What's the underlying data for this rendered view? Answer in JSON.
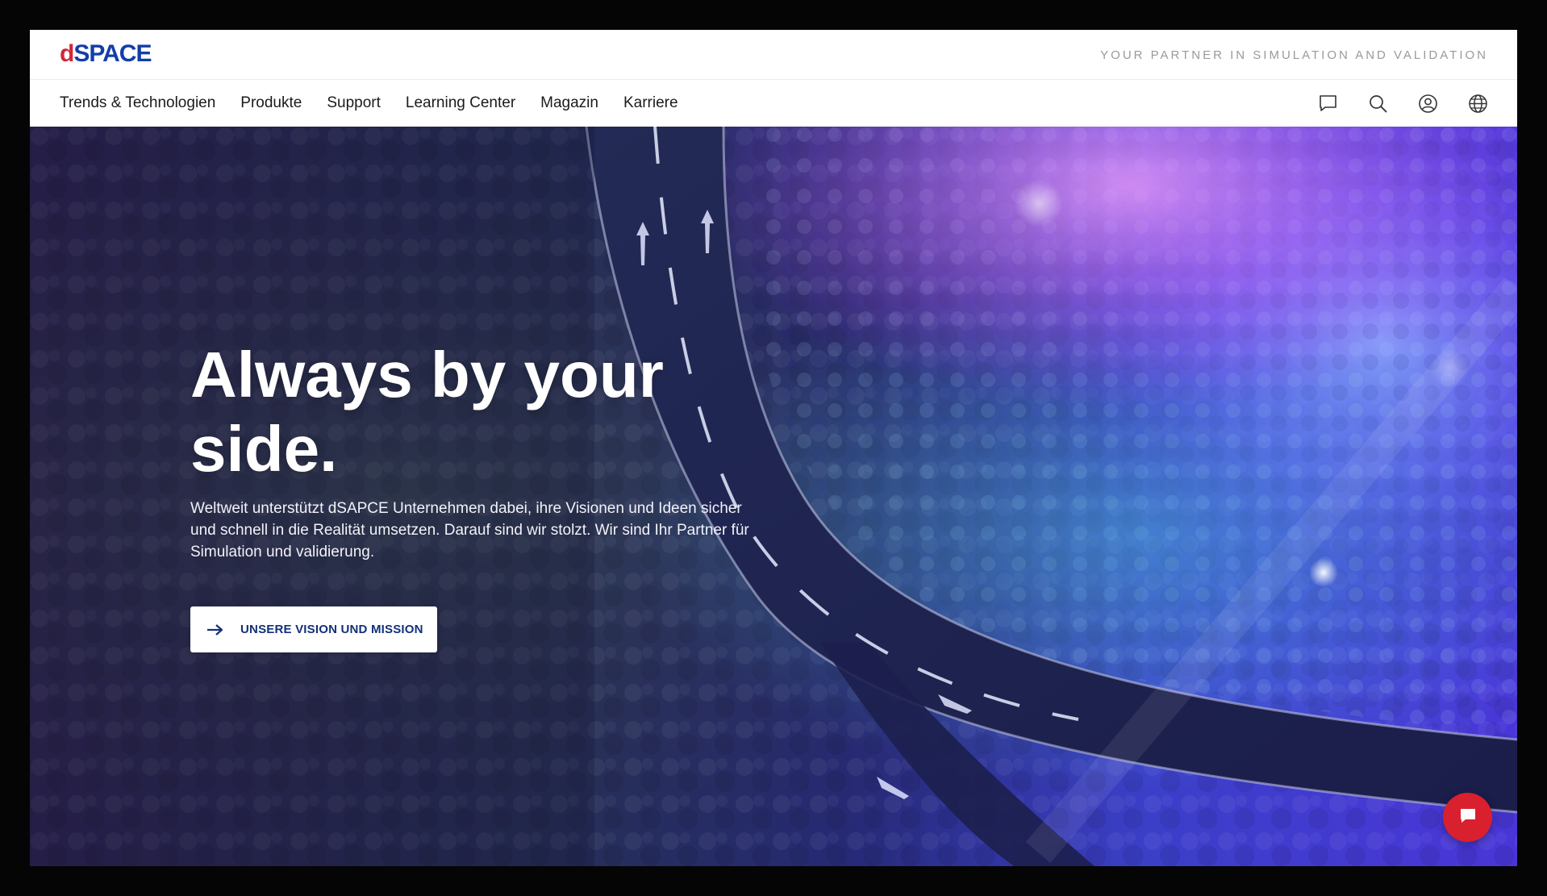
{
  "header": {
    "logo_prefix": "d",
    "logo_main": "SPACE",
    "tagline": "YOUR PARTNER IN SIMULATION AND VALIDATION"
  },
  "nav": {
    "items": [
      {
        "label": "Trends & Technologien"
      },
      {
        "label": "Produkte"
      },
      {
        "label": "Support"
      },
      {
        "label": "Learning Center"
      },
      {
        "label": "Magazin"
      },
      {
        "label": "Karriere"
      }
    ],
    "icons": [
      "chat-bubble-icon",
      "search-icon",
      "user-account-icon",
      "globe-icon"
    ]
  },
  "hero": {
    "title": "Always by your side.",
    "text": "Weltweit unterstützt dSAPCE Unternehmen dabei, ihre Visionen und Ideen sicher und schnell in die Realität umsetzen. Darauf sind wir stolzt. Wir sind Ihr Partner für Simulation und validierung.",
    "cta_label": "UNSERE VISION UND MISSION",
    "cta_icon": "arrow-right-icon",
    "chat_fab_icon": "chat-icon"
  },
  "colors": {
    "brand_blue": "#123ea8",
    "brand_red": "#d3263b",
    "cta_text": "#13307a",
    "chat_fab": "#d8202f"
  }
}
